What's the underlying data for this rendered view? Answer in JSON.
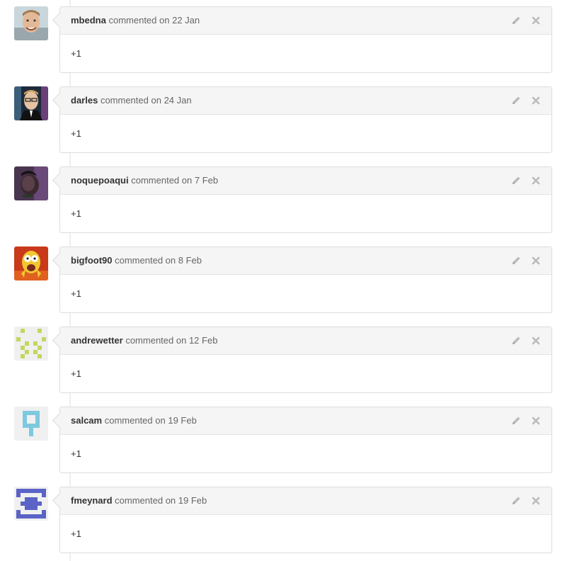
{
  "comments": [
    {
      "author": "mbedna",
      "action": "commented on",
      "date": "22 Jan",
      "body": "+1",
      "avatar": "photo-man-smiling"
    },
    {
      "author": "darles",
      "action": "commented on",
      "date": "24 Jan",
      "body": "+1",
      "avatar": "photo-man-glasses"
    },
    {
      "author": "noquepoaqui",
      "action": "commented on",
      "date": "7 Feb",
      "body": "+1",
      "avatar": "photo-dark-purple"
    },
    {
      "author": "bigfoot90",
      "action": "commented on",
      "date": "8 Feb",
      "body": "+1",
      "avatar": "cartoon-yellow-character"
    },
    {
      "author": "andrewetter",
      "action": "commented on",
      "date": "12 Feb",
      "body": "+1",
      "avatar": "identicon-lime"
    },
    {
      "author": "salcam",
      "action": "commented on",
      "date": "19 Feb",
      "body": "+1",
      "avatar": "identicon-light-blue"
    },
    {
      "author": "fmeynard",
      "action": "commented on",
      "date": "19 Feb",
      "body": "+1",
      "avatar": "identicon-indigo"
    }
  ],
  "icons": {
    "edit": "pencil-icon",
    "delete": "close-icon"
  },
  "colors": {
    "icon_gray": "#bbbbbb",
    "header_bg": "#f5f5f5",
    "border": "#dddddd"
  }
}
